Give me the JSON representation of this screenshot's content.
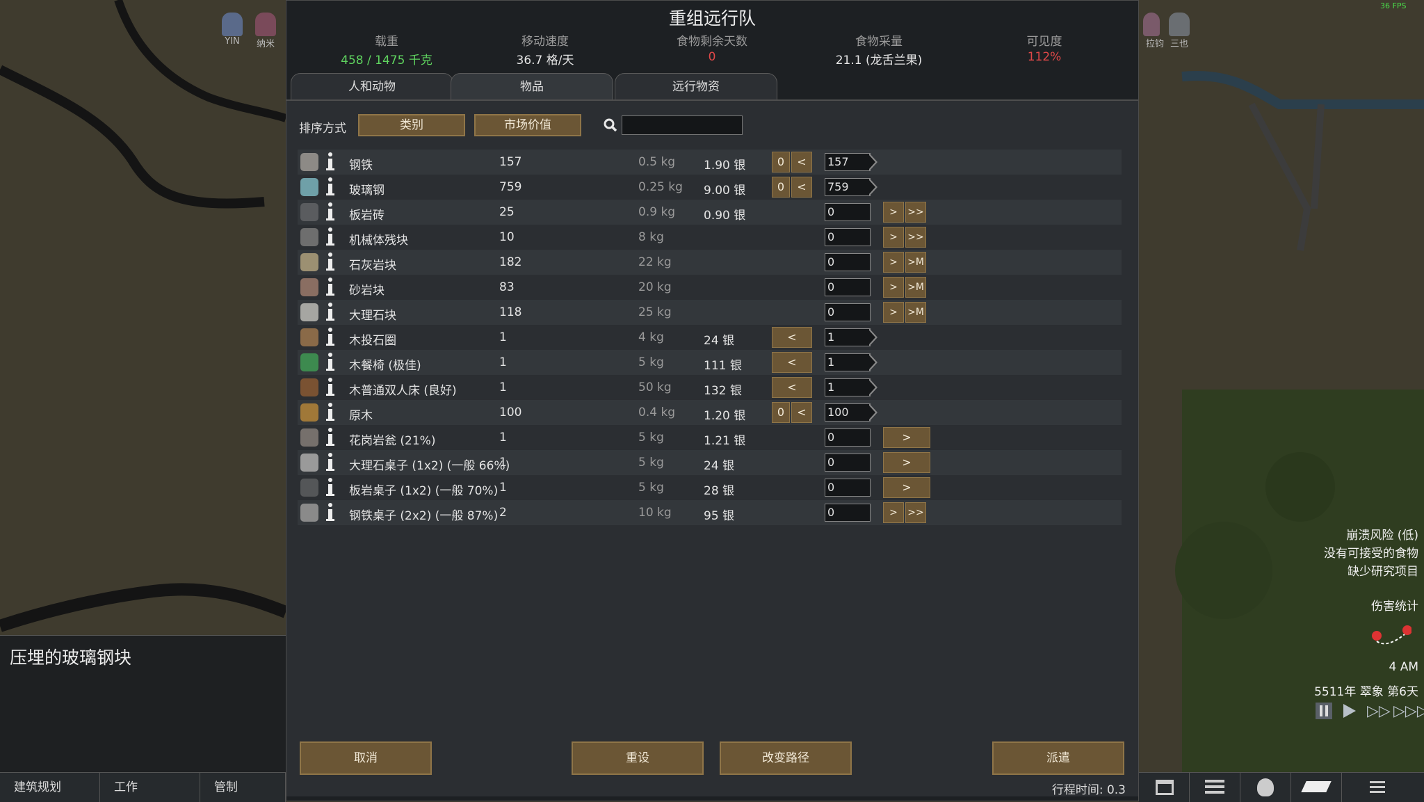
{
  "fps": "36 FPS",
  "dialog": {
    "title": "重组远行队",
    "stats": [
      {
        "label": "载重",
        "value": "458 / 1475 千克",
        "color": "#5fd35f"
      },
      {
        "label": "移动速度",
        "value": "36.7 格/天",
        "color": "#e6e6e6"
      },
      {
        "label": "食物剩余天数",
        "value": "0",
        "color": "#e04848"
      },
      {
        "label": "食物采量",
        "value": "21.1 (龙舌兰果)",
        "color": "#e6e6e6"
      },
      {
        "label": "可见度",
        "value": "112%",
        "color": "#e04848"
      }
    ],
    "tabs": [
      "人和动物",
      "物品",
      "远行物资"
    ],
    "active_tab": "物品",
    "sort_label": "排序方式",
    "sort_buttons": [
      "类别",
      "市场价值"
    ],
    "search_placeholder": "",
    "rows": [
      {
        "name": "钢铁",
        "count": "157",
        "mass": "0.5 kg",
        "price": "1.90 银",
        "left_zero": "0",
        "left_arrow": "<",
        "qty": "157",
        "right": [],
        "icon_color": "#8d8a86"
      },
      {
        "name": "玻璃钢",
        "count": "759",
        "mass": "0.25 kg",
        "price": "9.00 银",
        "left_zero": "0",
        "left_arrow": "<",
        "qty": "759",
        "right": [],
        "icon_color": "#6fa0a8"
      },
      {
        "name": "板岩砖",
        "count": "25",
        "mass": "0.9 kg",
        "price": "0.90 银",
        "left_zero": "",
        "left_arrow": "",
        "qty": "0",
        "right": [
          ">",
          ">>"
        ],
        "icon_color": "#5a5c5f"
      },
      {
        "name": "机械体残块",
        "count": "10",
        "mass": "8 kg",
        "price": "",
        "left_zero": "",
        "left_arrow": "",
        "qty": "0",
        "right": [
          ">",
          ">>"
        ],
        "icon_color": "#6e6e6e"
      },
      {
        "name": "石灰岩块",
        "count": "182",
        "mass": "22 kg",
        "price": "",
        "left_zero": "",
        "left_arrow": "",
        "qty": "0",
        "right": [
          ">",
          ">M"
        ],
        "icon_color": "#9c9072"
      },
      {
        "name": "砂岩块",
        "count": "83",
        "mass": "20 kg",
        "price": "",
        "left_zero": "",
        "left_arrow": "",
        "qty": "0",
        "right": [
          ">",
          ">M"
        ],
        "icon_color": "#8a6e62"
      },
      {
        "name": "大理石块",
        "count": "118",
        "mass": "25 kg",
        "price": "",
        "left_zero": "",
        "left_arrow": "",
        "qty": "0",
        "right": [
          ">",
          ">M"
        ],
        "icon_color": "#a6a6a2"
      },
      {
        "name": "木投石圈",
        "count": "1",
        "mass": "4 kg",
        "price": "24 银",
        "left_zero": "",
        "left_arrow": "<",
        "qty": "1",
        "right": [],
        "icon_color": "#8a6a48"
      },
      {
        "name": "木餐椅 (极佳)",
        "count": "1",
        "mass": "5 kg",
        "price": "111 银",
        "left_zero": "",
        "left_arrow": "<",
        "qty": "1",
        "right": [],
        "icon_color": "#3d8a4f"
      },
      {
        "name": "木普通双人床 (良好)",
        "count": "1",
        "mass": "50 kg",
        "price": "132 银",
        "left_zero": "",
        "left_arrow": "<",
        "qty": "1",
        "right": [],
        "icon_color": "#7a5232"
      },
      {
        "name": "原木",
        "count": "100",
        "mass": "0.4 kg",
        "price": "1.20 银",
        "left_zero": "0",
        "left_arrow": "<",
        "qty": "100",
        "right": [],
        "icon_color": "#a07838"
      },
      {
        "name": "花岗岩瓮 (21%)",
        "count": "1",
        "mass": "5 kg",
        "price": "1.21 银",
        "left_zero": "",
        "left_arrow": "",
        "qty": "0",
        "right": [
          "> wide"
        ],
        "icon_color": "#76706c"
      },
      {
        "name": "大理石桌子 (1x2) (一般 66%)",
        "count": "1",
        "mass": "5 kg",
        "price": "24 银",
        "left_zero": "",
        "left_arrow": "",
        "qty": "0",
        "right": [
          "> wide"
        ],
        "icon_color": "#9a9a9a"
      },
      {
        "name": "板岩桌子 (1x2) (一般 70%)",
        "count": "1",
        "mass": "5 kg",
        "price": "28 银",
        "left_zero": "",
        "left_arrow": "",
        "qty": "0",
        "right": [
          "> wide"
        ],
        "icon_color": "#545658"
      },
      {
        "name": "钢铁桌子 (2x2) (一般 87%)",
        "count": "2",
        "mass": "10 kg",
        "price": "95 银",
        "left_zero": "",
        "left_arrow": "",
        "qty": "0",
        "right": [
          ">",
          ">>"
        ],
        "icon_color": "#8a8a8a"
      }
    ],
    "footer": {
      "cancel": "取消",
      "reset": "重设",
      "change_route": "改变路径",
      "send": "派遣",
      "travel_time": "行程时间: 0.3"
    }
  },
  "info_panel": {
    "title": "压埋的玻璃钢块"
  },
  "bottom_tabs": [
    "建筑规划",
    "工作",
    "管制"
  ],
  "alerts": [
    "崩溃风险 (低)",
    "没有可接受的食物",
    "缺少研究项目"
  ],
  "damage_stats": "伤害统计",
  "time": "4 AM",
  "date": "5511年 翠象 第6天",
  "colonists_left": [
    "YIN",
    "纳米"
  ],
  "colonists_right": [
    "拉钧",
    "三也"
  ]
}
